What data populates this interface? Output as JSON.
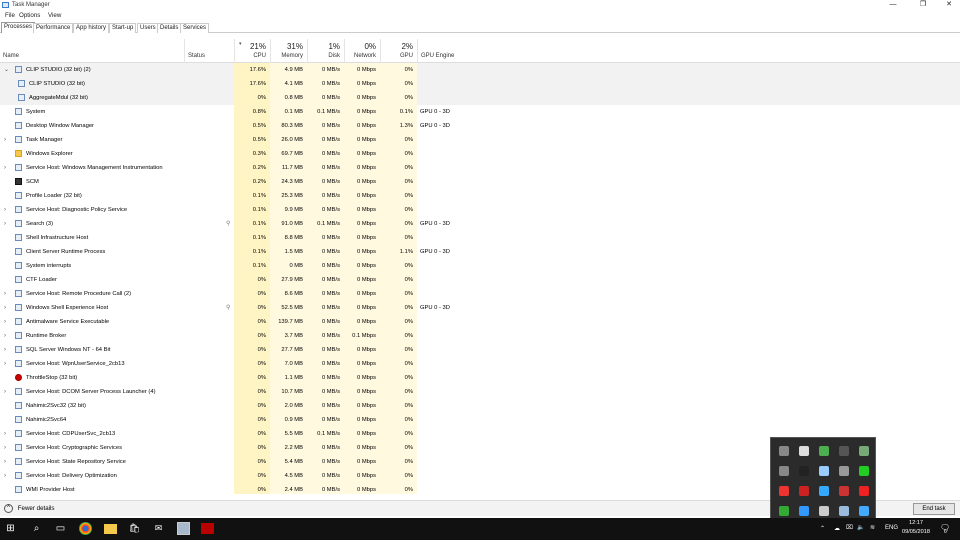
{
  "window": {
    "title": "Task Manager",
    "controls": [
      "—",
      "❐",
      "✕"
    ]
  },
  "menu": [
    "File",
    "Options",
    "View"
  ],
  "tabs": [
    "Processes",
    "Performance",
    "App history",
    "Start-up",
    "Users",
    "Details",
    "Services"
  ],
  "header": {
    "name_label": "Name",
    "status_label": "Status",
    "cpu": {
      "pct": "21%",
      "label": "CPU"
    },
    "memory": {
      "pct": "31%",
      "label": "Memory"
    },
    "disk": {
      "pct": "1%",
      "label": "Disk"
    },
    "network": {
      "pct": "0%",
      "label": "Network"
    },
    "gpu": {
      "pct": "2%",
      "label": "GPU"
    },
    "gpu_engine_label": "GPU Engine"
  },
  "processes": [
    {
      "name": "CLIP STUDIO (32 bit) (2)",
      "cpu": "17.6%",
      "mem": "4.9 MB",
      "disk": "0 MB/s",
      "net": "0 Mbps",
      "gpu": "0%",
      "engine": "",
      "exp": "v",
      "icon": "app",
      "group": true,
      "indent": 0
    },
    {
      "name": "CLIP STUDIO (32 bit)",
      "cpu": "17.6%",
      "mem": "4.1 MB",
      "disk": "0 MB/s",
      "net": "0 Mbps",
      "gpu": "0%",
      "engine": "",
      "exp": "",
      "icon": "app",
      "group": true,
      "indent": 1
    },
    {
      "name": "AggregateMdul (32 bit)",
      "cpu": "0%",
      "mem": "0.8 MB",
      "disk": "0 MB/s",
      "net": "0 Mbps",
      "gpu": "0%",
      "engine": "",
      "exp": "",
      "icon": "app",
      "group": true,
      "indent": 1
    },
    {
      "name": "System",
      "cpu": "0.8%",
      "mem": "0.1 MB",
      "disk": "0.1 MB/s",
      "net": "0 Mbps",
      "gpu": "0.1%",
      "engine": "GPU 0 - 3D",
      "exp": "",
      "icon": "app",
      "indent": 0
    },
    {
      "name": "Desktop Window Manager",
      "cpu": "0.5%",
      "mem": "80.3 MB",
      "disk": "0 MB/s",
      "net": "0 Mbps",
      "gpu": "1.3%",
      "engine": "GPU 0 - 3D",
      "exp": "",
      "icon": "app",
      "indent": 0
    },
    {
      "name": "Task Manager",
      "cpu": "0.5%",
      "mem": "26.0 MB",
      "disk": "0 MB/s",
      "net": "0 Mbps",
      "gpu": "0%",
      "engine": "",
      "exp": ">",
      "icon": "app",
      "indent": 0
    },
    {
      "name": "Windows Explorer",
      "cpu": "0.3%",
      "mem": "69.7 MB",
      "disk": "0 MB/s",
      "net": "0 Mbps",
      "gpu": "0%",
      "engine": "",
      "exp": "",
      "icon": "folder",
      "indent": 0
    },
    {
      "name": "Service Host: Windows Management Instrumentation",
      "cpu": "0.2%",
      "mem": "11.7 MB",
      "disk": "0 MB/s",
      "net": "0 Mbps",
      "gpu": "0%",
      "engine": "",
      "exp": ">",
      "icon": "app",
      "indent": 0
    },
    {
      "name": "SCM",
      "cpu": "0.2%",
      "mem": "24.3 MB",
      "disk": "0 MB/s",
      "net": "0 Mbps",
      "gpu": "0%",
      "engine": "",
      "exp": "",
      "icon": "dark",
      "indent": 0
    },
    {
      "name": "Profile Loader (32 bit)",
      "cpu": "0.1%",
      "mem": "25.3 MB",
      "disk": "0 MB/s",
      "net": "0 Mbps",
      "gpu": "0%",
      "engine": "",
      "exp": "",
      "icon": "app",
      "indent": 0
    },
    {
      "name": "Service Host: Diagnostic Policy Service",
      "cpu": "0.1%",
      "mem": "9.9 MB",
      "disk": "0 MB/s",
      "net": "0 Mbps",
      "gpu": "0%",
      "engine": "",
      "exp": ">",
      "icon": "app",
      "indent": 0
    },
    {
      "name": "Search (3)",
      "cpu": "0.1%",
      "mem": "91.0 MB",
      "disk": "0.1 MB/s",
      "net": "0 Mbps",
      "gpu": "0%",
      "engine": "GPU 0 - 3D",
      "exp": ">",
      "icon": "app",
      "leaf": true,
      "indent": 0
    },
    {
      "name": "Shell Infrastructure Host",
      "cpu": "0.1%",
      "mem": "8.8 MB",
      "disk": "0 MB/s",
      "net": "0 Mbps",
      "gpu": "0%",
      "engine": "",
      "exp": "",
      "icon": "app",
      "indent": 0
    },
    {
      "name": "Client Server Runtime Process",
      "cpu": "0.1%",
      "mem": "1.5 MB",
      "disk": "0 MB/s",
      "net": "0 Mbps",
      "gpu": "1.1%",
      "engine": "GPU 0 - 3D",
      "exp": "",
      "icon": "app",
      "indent": 0
    },
    {
      "name": "System interrupts",
      "cpu": "0.1%",
      "mem": "0 MB",
      "disk": "0 MB/s",
      "net": "0 Mbps",
      "gpu": "0%",
      "engine": "",
      "exp": "",
      "icon": "app",
      "indent": 0
    },
    {
      "name": "CTF Loader",
      "cpu": "0%",
      "mem": "27.9 MB",
      "disk": "0 MB/s",
      "net": "0 Mbps",
      "gpu": "0%",
      "engine": "",
      "exp": "",
      "icon": "app",
      "indent": 0
    },
    {
      "name": "Service Host: Remote Procedure Call (2)",
      "cpu": "0%",
      "mem": "8.6 MB",
      "disk": "0 MB/s",
      "net": "0 Mbps",
      "gpu": "0%",
      "engine": "",
      "exp": ">",
      "icon": "app",
      "indent": 0
    },
    {
      "name": "Windows Shell Experience Host",
      "cpu": "0%",
      "mem": "52.5 MB",
      "disk": "0 MB/s",
      "net": "0 Mbps",
      "gpu": "0%",
      "engine": "GPU 0 - 3D",
      "exp": ">",
      "icon": "app",
      "leaf": true,
      "indent": 0
    },
    {
      "name": "Antimalware Service Executable",
      "cpu": "0%",
      "mem": "139.7 MB",
      "disk": "0 MB/s",
      "net": "0 Mbps",
      "gpu": "0%",
      "engine": "",
      "exp": ">",
      "icon": "app",
      "indent": 0
    },
    {
      "name": "Runtime Broker",
      "cpu": "0%",
      "mem": "3.7 MB",
      "disk": "0 MB/s",
      "net": "0.1 Mbps",
      "gpu": "0%",
      "engine": "",
      "exp": ">",
      "icon": "app",
      "indent": 0
    },
    {
      "name": "SQL Server Windows NT - 64 Bit",
      "cpu": "0%",
      "mem": "27.7 MB",
      "disk": "0 MB/s",
      "net": "0 Mbps",
      "gpu": "0%",
      "engine": "",
      "exp": ">",
      "icon": "app",
      "indent": 0
    },
    {
      "name": "Service Host: WpnUserService_2cb13",
      "cpu": "0%",
      "mem": "7.0 MB",
      "disk": "0 MB/s",
      "net": "0 Mbps",
      "gpu": "0%",
      "engine": "",
      "exp": ">",
      "icon": "app",
      "indent": 0
    },
    {
      "name": "ThrottleStop (32 bit)",
      "cpu": "0%",
      "mem": "1.1 MB",
      "disk": "0 MB/s",
      "net": "0 Mbps",
      "gpu": "0%",
      "engine": "",
      "exp": "",
      "icon": "red",
      "indent": 0
    },
    {
      "name": "Service Host: DCOM Server Process Launcher (4)",
      "cpu": "0%",
      "mem": "10.7 MB",
      "disk": "0 MB/s",
      "net": "0 Mbps",
      "gpu": "0%",
      "engine": "",
      "exp": ">",
      "icon": "app",
      "indent": 0
    },
    {
      "name": "Nahimic2Svc32 (32 bit)",
      "cpu": "0%",
      "mem": "2.0 MB",
      "disk": "0 MB/s",
      "net": "0 Mbps",
      "gpu": "0%",
      "engine": "",
      "exp": "",
      "icon": "app",
      "indent": 0
    },
    {
      "name": "Nahimic2Svc64",
      "cpu": "0%",
      "mem": "0.9 MB",
      "disk": "0 MB/s",
      "net": "0 Mbps",
      "gpu": "0%",
      "engine": "",
      "exp": "",
      "icon": "app",
      "indent": 0
    },
    {
      "name": "Service Host: CDPUserSvc_2cb13",
      "cpu": "0%",
      "mem": "5.5 MB",
      "disk": "0.1 MB/s",
      "net": "0 Mbps",
      "gpu": "0%",
      "engine": "",
      "exp": ">",
      "icon": "app",
      "indent": 0
    },
    {
      "name": "Service Host: Cryptographic Services",
      "cpu": "0%",
      "mem": "2.2 MB",
      "disk": "0 MB/s",
      "net": "0 Mbps",
      "gpu": "0%",
      "engine": "",
      "exp": ">",
      "icon": "app",
      "indent": 0
    },
    {
      "name": "Service Host: State Repository Service",
      "cpu": "0%",
      "mem": "5.4 MB",
      "disk": "0 MB/s",
      "net": "0 Mbps",
      "gpu": "0%",
      "engine": "",
      "exp": ">",
      "icon": "app",
      "indent": 0
    },
    {
      "name": "Service Host: Delivery Optimization",
      "cpu": "0%",
      "mem": "4.5 MB",
      "disk": "0 MB/s",
      "net": "0 Mbps",
      "gpu": "0%",
      "engine": "",
      "exp": ">",
      "icon": "app",
      "indent": 0
    },
    {
      "name": "WMI Provider Host",
      "cpu": "0%",
      "mem": "2.4 MB",
      "disk": "0 MB/s",
      "net": "0 Mbps",
      "gpu": "0%",
      "engine": "",
      "exp": "",
      "icon": "app",
      "indent": 0
    }
  ],
  "footer": {
    "fewer_details": "Fewer details",
    "end_task": "End task"
  },
  "taskbar": {
    "lang": "ENG",
    "time": "12:17",
    "date": "09/05/2018",
    "notif_count": "6"
  },
  "tray_icons": [
    "#888",
    "#ddd",
    "#4caf50",
    "#555",
    "#7a7",
    "#888",
    "#222",
    "#9cf",
    "#999",
    "#2c2",
    "#e33",
    "#c22",
    "#3af",
    "#c33",
    "#e22",
    "#3a3",
    "#39f",
    "#ccc",
    "#9bd",
    "#4af"
  ],
  "taskbar_icons": [
    "windows-start-icon",
    "search-icon",
    "task-view-icon",
    "chrome-icon",
    "file-explorer-icon",
    "store-icon",
    "mail-icon",
    "task-manager-icon",
    "filezilla-icon"
  ],
  "colors": {
    "cpu_bg": "#fff4c4",
    "mem_bg": "#fff9e0",
    "accent": "#0078d7"
  }
}
